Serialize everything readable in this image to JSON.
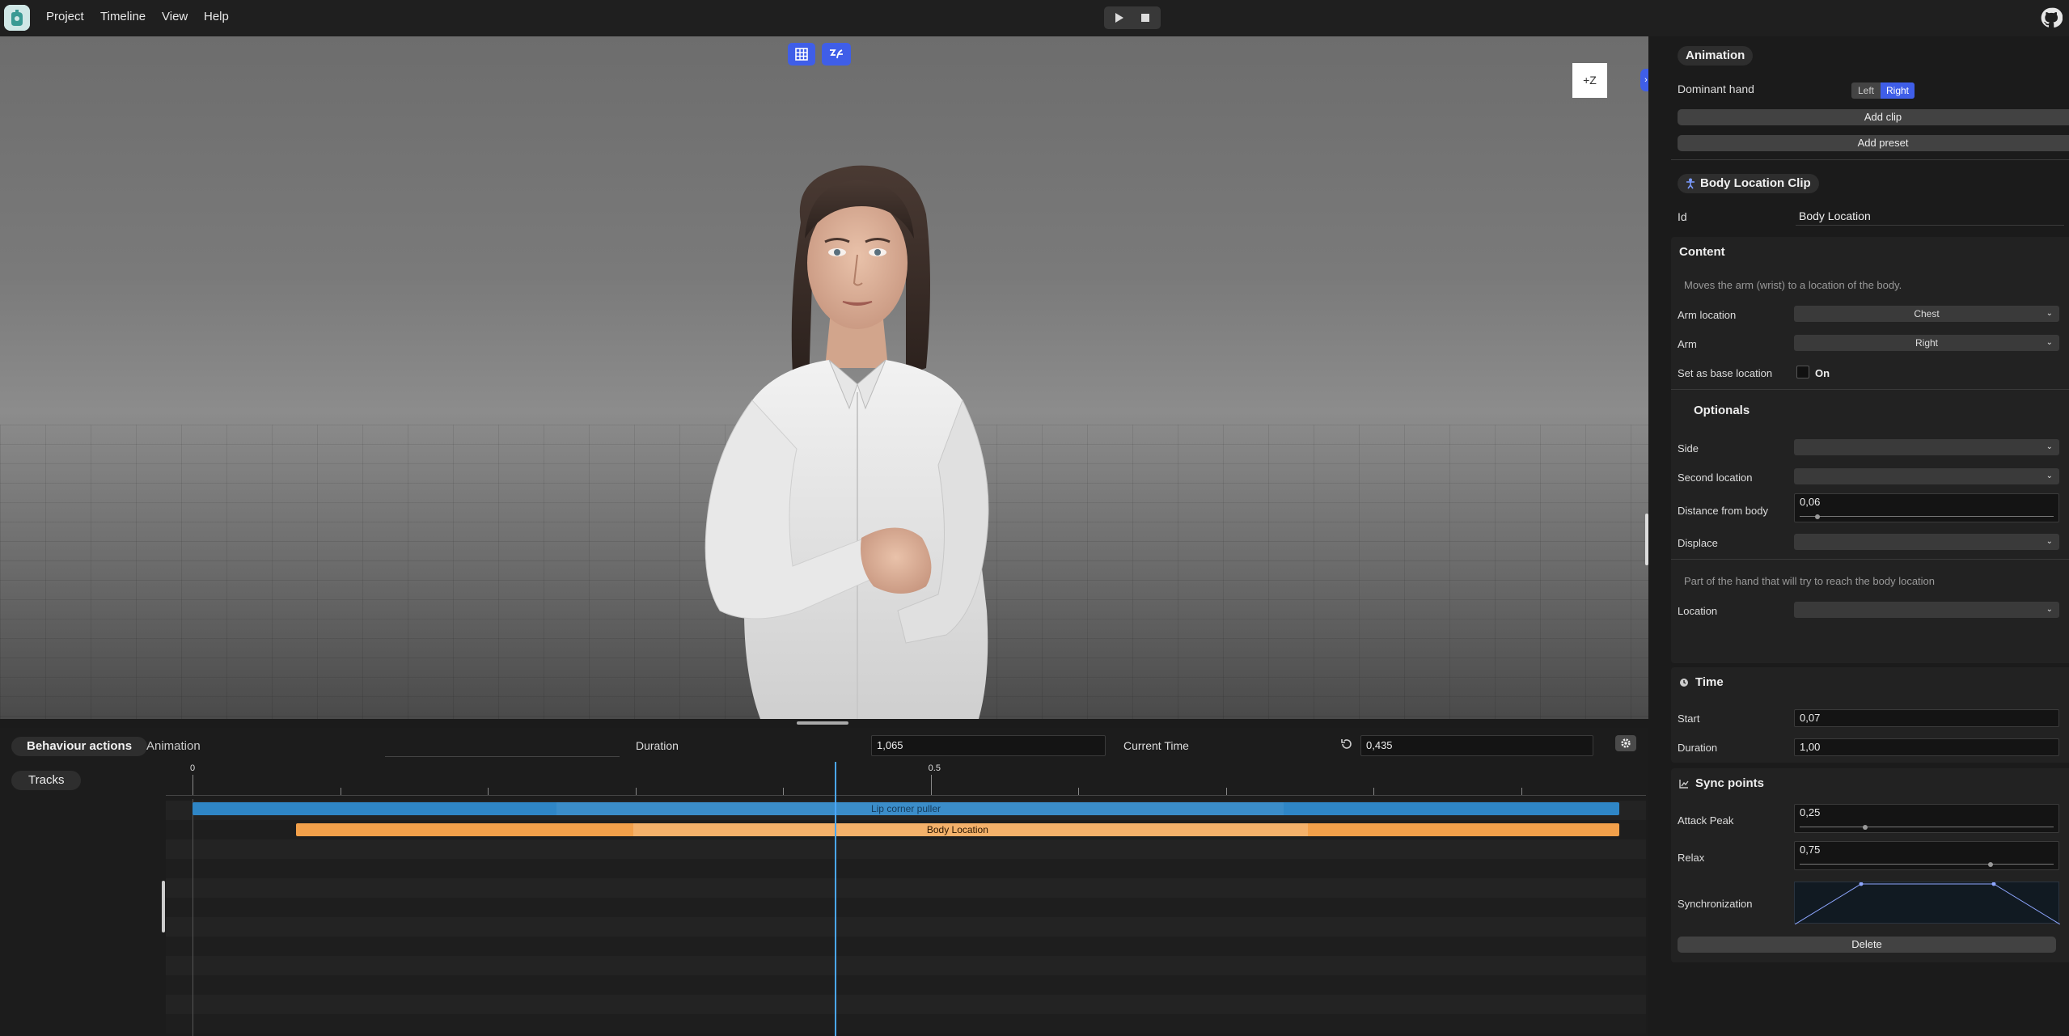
{
  "menubar": {
    "items": [
      "Project",
      "Timeline",
      "View",
      "Help"
    ]
  },
  "viewport": {
    "axis_label": "+Z"
  },
  "timeline": {
    "tabs": [
      "Behaviour actions",
      "Animation"
    ],
    "tracks_label": "Tracks",
    "duration_label": "Duration",
    "duration_value": "1,065",
    "current_time_label": "Current Time",
    "current_time_value": "0,435",
    "ruler_labels": [
      "0",
      "0.5"
    ],
    "clips": [
      {
        "label": "Lip corner puller",
        "color": "#2f86c6",
        "start": 0.0,
        "end": 1.0
      },
      {
        "label": "Body Location",
        "color": "#f2a04a",
        "start": 0.07,
        "end": 1.07
      }
    ],
    "playhead_time": 0.435,
    "total_time": 1.065
  },
  "panel": {
    "animation_title": "Animation",
    "dominant_hand_label": "Dominant hand",
    "hand_options": [
      "Left",
      "Right"
    ],
    "hand_selected": "Right",
    "add_clip": "Add clip",
    "add_preset": "Add preset",
    "clip_title": "Body Location Clip",
    "id_label": "Id",
    "id_value": "Body Location",
    "content": {
      "title": "Content",
      "description": "Moves the arm (wrist) to a location of the body.",
      "arm_location_label": "Arm location",
      "arm_location_value": "Chest",
      "arm_label": "Arm",
      "arm_value": "Right",
      "base_location_label": "Set as base location",
      "base_location_value": "On",
      "optionals_title": "Optionals",
      "side_label": "Side",
      "second_location_label": "Second location",
      "distance_label": "Distance from body",
      "distance_value": "0,06",
      "distance_fraction": 0.06,
      "displace_label": "Displace",
      "hand_part_description": "Part of the hand that will try to reach the body location",
      "location_label": "Location"
    },
    "time": {
      "title": "Time",
      "start_label": "Start",
      "start_value": "0,07",
      "duration_label": "Duration",
      "duration_value": "1,00"
    },
    "sync": {
      "title": "Sync points",
      "attack_label": "Attack Peak",
      "attack_value": "0,25",
      "attack_fraction": 0.25,
      "relax_label": "Relax",
      "relax_value": "0,75",
      "relax_fraction": 0.75,
      "sync_label": "Synchronization"
    },
    "delete": "Delete"
  },
  "colors": {
    "accent": "#3f5ee8",
    "clip_blue": "#2f86c6",
    "clip_orange": "#f2a04a",
    "playhead": "#4aa7ff"
  }
}
